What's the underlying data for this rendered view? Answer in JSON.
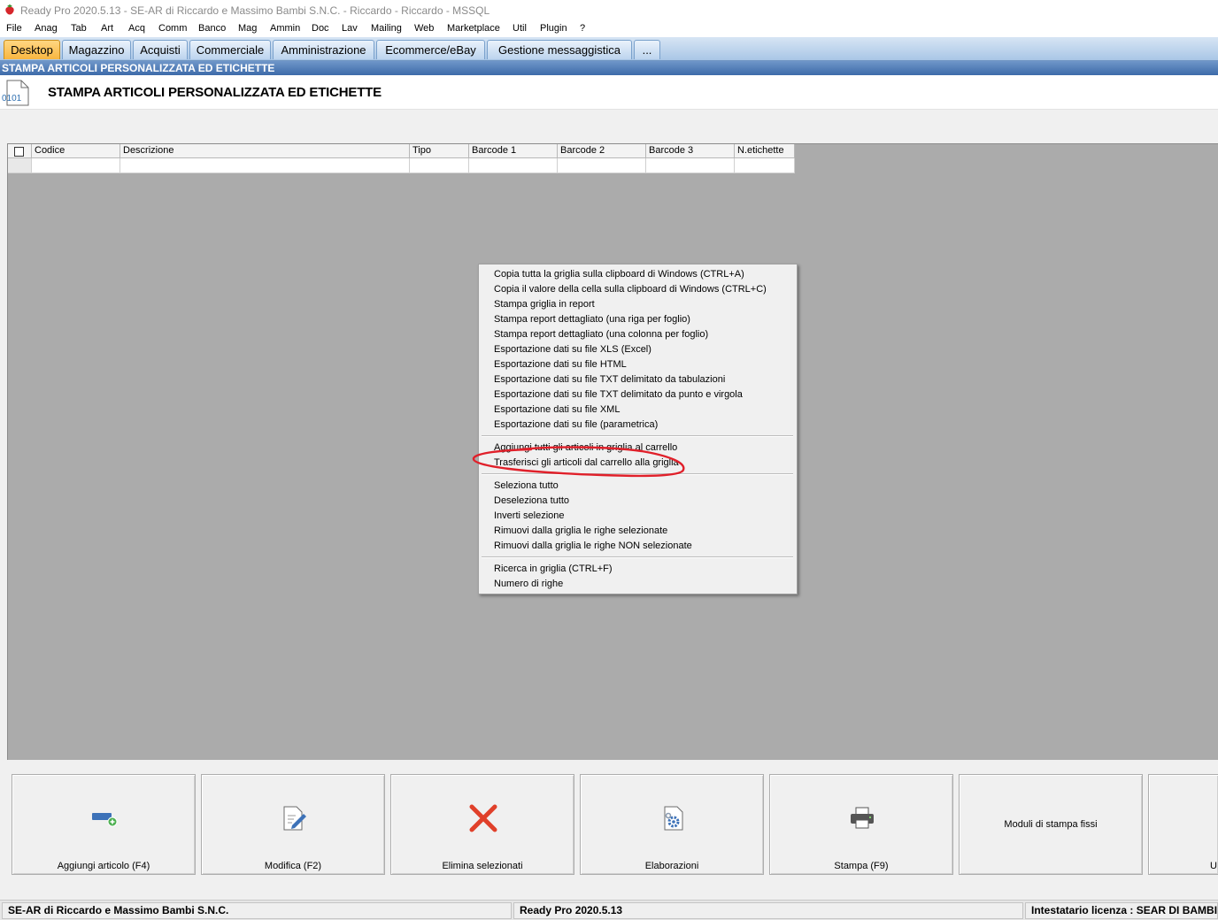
{
  "window": {
    "title": "Ready Pro 2020.5.13 - SE-AR di Riccardo e Massimo Bambi S.N.C. - Riccardo - Riccardo - MSSQL",
    "icon": "strawberry-icon"
  },
  "menu": [
    "File",
    "Anag",
    "Tab",
    "Art",
    "Acq",
    "Comm",
    "Banco",
    "Mag",
    "Ammin",
    "Doc",
    "Lav",
    "Mailing",
    "Web",
    "Marketplace",
    "Util",
    "Plugin",
    "?"
  ],
  "tabs": [
    {
      "label": "Desktop",
      "active": true
    },
    {
      "label": "Magazzino"
    },
    {
      "label": "Acquisti"
    },
    {
      "label": "Commerciale"
    },
    {
      "label": "Amministrazione"
    },
    {
      "label": "Ecommerce/eBay"
    },
    {
      "label": "Gestione messaggistica"
    },
    {
      "label": "..."
    }
  ],
  "form": {
    "caption": "STAMPA ARTICOLI PERSONALIZZATA ED ETICHETTE",
    "title": "STAMPA ARTICOLI PERSONALIZZATA ED ETICHETTE",
    "icon_text": "0101"
  },
  "grid": {
    "columns": [
      "Codice",
      "Descrizione",
      "Tipo",
      "Barcode 1",
      "Barcode 2",
      "Barcode 3",
      "N.etichette"
    ]
  },
  "context_menu": {
    "group1": [
      "Copia tutta la griglia sulla clipboard di Windows (CTRL+A)",
      "Copia il valore della cella sulla clipboard di Windows (CTRL+C)",
      "Stampa griglia in report",
      "Stampa report dettagliato (una riga per foglio)",
      "Stampa report dettagliato (una colonna per foglio)",
      "Esportazione dati su file XLS (Excel)",
      "Esportazione dati su file HTML",
      "Esportazione dati su file TXT delimitato da tabulazioni",
      "Esportazione dati su file TXT delimitato da punto e virgola",
      "Esportazione dati su file XML",
      "Esportazione dati su file (parametrica)"
    ],
    "group2": [
      "Aggiungi tutti gli articoli in griglia al carrello",
      "Trasferisci gli articoli dal carrello alla griglia"
    ],
    "group3": [
      "Seleziona tutto",
      "Deseleziona tutto",
      "Inverti selezione",
      "Rimuovi dalla griglia le righe selezionate",
      "Rimuovi dalla griglia le righe NON selezionate"
    ],
    "group4": [
      "Ricerca in griglia (CTRL+F)",
      "Numero di righe"
    ],
    "highlight_color": "#e0202a"
  },
  "buttons": [
    {
      "label": "Aggiungi articolo (F4)",
      "icon": "add-item-icon"
    },
    {
      "label": "Modifica (F2)",
      "icon": "edit-document-icon"
    },
    {
      "label": "Elimina selezionati",
      "icon": "delete-x-icon"
    },
    {
      "label": "Elaborazioni",
      "icon": "gear-document-icon"
    },
    {
      "label": "Stampa (F9)",
      "icon": "printer-icon"
    },
    {
      "label": "Moduli di stampa fissi"
    },
    {
      "label": "U"
    }
  ],
  "status": {
    "company": "SE-AR di Riccardo e Massimo Bambi S.N.C.",
    "version": "Ready Pro 2020.5.13",
    "license": "Intestatario licenza : SEAR DI BAMBI"
  }
}
